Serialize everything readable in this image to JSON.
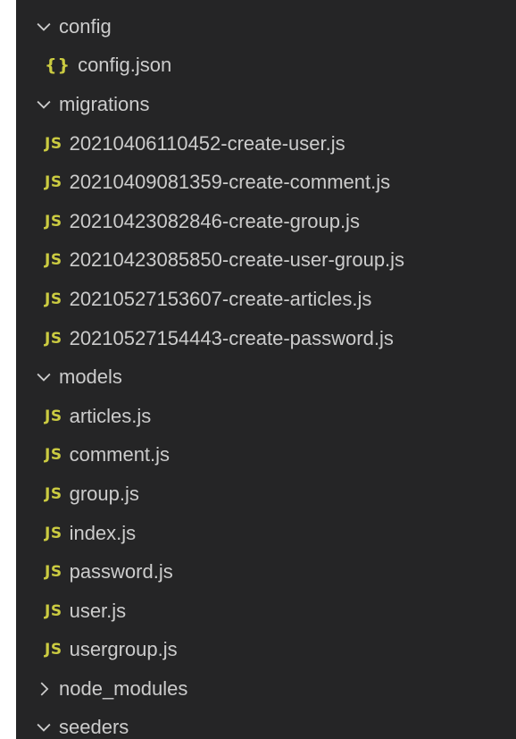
{
  "explorer": {
    "items": [
      {
        "kind": "folder",
        "state": "open",
        "label": "config",
        "icon": "chevron-down-icon"
      },
      {
        "kind": "file",
        "type": "json",
        "badge": "{}",
        "label": "config.json",
        "icon": "json-file-icon"
      },
      {
        "kind": "folder",
        "state": "open",
        "label": "migrations",
        "icon": "chevron-down-icon"
      },
      {
        "kind": "file",
        "type": "js",
        "badge": "JS",
        "label": "20210406110452-create-user.js",
        "icon": "javascript-file-icon"
      },
      {
        "kind": "file",
        "type": "js",
        "badge": "JS",
        "label": "20210409081359-create-comment.js",
        "icon": "javascript-file-icon"
      },
      {
        "kind": "file",
        "type": "js",
        "badge": "JS",
        "label": "20210423082846-create-group.js",
        "icon": "javascript-file-icon"
      },
      {
        "kind": "file",
        "type": "js",
        "badge": "JS",
        "label": "20210423085850-create-user-group.js",
        "icon": "javascript-file-icon"
      },
      {
        "kind": "file",
        "type": "js",
        "badge": "JS",
        "label": "20210527153607-create-articles.js",
        "icon": "javascript-file-icon"
      },
      {
        "kind": "file",
        "type": "js",
        "badge": "JS",
        "label": "20210527154443-create-password.js",
        "icon": "javascript-file-icon"
      },
      {
        "kind": "folder",
        "state": "open",
        "label": "models",
        "icon": "chevron-down-icon"
      },
      {
        "kind": "file",
        "type": "js",
        "badge": "JS",
        "label": "articles.js",
        "icon": "javascript-file-icon"
      },
      {
        "kind": "file",
        "type": "js",
        "badge": "JS",
        "label": "comment.js",
        "icon": "javascript-file-icon"
      },
      {
        "kind": "file",
        "type": "js",
        "badge": "JS",
        "label": "group.js",
        "icon": "javascript-file-icon"
      },
      {
        "kind": "file",
        "type": "js",
        "badge": "JS",
        "label": "index.js",
        "icon": "javascript-file-icon"
      },
      {
        "kind": "file",
        "type": "js",
        "badge": "JS",
        "label": "password.js",
        "icon": "javascript-file-icon"
      },
      {
        "kind": "file",
        "type": "js",
        "badge": "JS",
        "label": "user.js",
        "icon": "javascript-file-icon"
      },
      {
        "kind": "file",
        "type": "js",
        "badge": "JS",
        "label": "usergroup.js",
        "icon": "javascript-file-icon"
      },
      {
        "kind": "folder",
        "state": "closed",
        "label": "node_modules",
        "icon": "chevron-right-icon"
      },
      {
        "kind": "folder",
        "state": "open",
        "label": "seeders",
        "icon": "chevron-down-icon"
      }
    ]
  },
  "colors": {
    "background": "#252526",
    "text": "#cccccc",
    "js_badge": "#cbcb41",
    "json_badge": "#cbcb41"
  }
}
